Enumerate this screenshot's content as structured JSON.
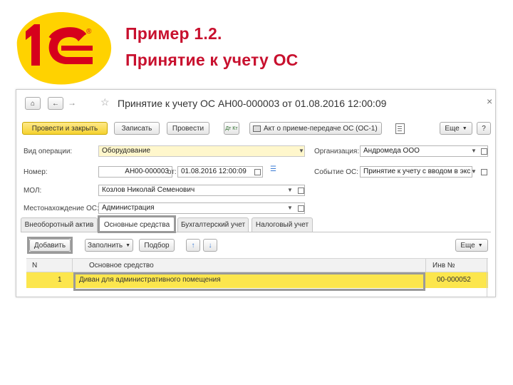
{
  "logo": {
    "text": "1С",
    "mark": "®"
  },
  "slide": {
    "title_line1": "Пример 1.2.",
    "title_line2": "Принятие к учету ОС"
  },
  "window": {
    "title": "Принятие к учету ОС АН00-000003 от 01.08.2016 12:00:09",
    "close": "×",
    "nav": {
      "home_icon": "⌂",
      "back_icon": "←",
      "forward_icon": "→",
      "star_icon": "☆"
    }
  },
  "toolbar": {
    "post_close": "Провести и закрыть",
    "save": "Записать",
    "post": "Провести",
    "dtkt": "Дт Кт",
    "act": "Акт о приеме-передаче ОС (ОС-1)",
    "more": "Еще",
    "help": "?"
  },
  "form": {
    "operation_label": "Вид операции:",
    "operation_value": "Оборудование",
    "number_label": "Номер:",
    "number_value": "АН00-000003",
    "date_from_label": "от:",
    "date_value": "01.08.2016 12:00:09",
    "mol_label": "МОЛ:",
    "mol_value": "Козлов Николай Семенович",
    "location_label": "Местонахождение ОС:",
    "location_value": "Администрация",
    "org_label": "Организация:",
    "org_value": "Андромеда ООО",
    "event_label": "Событие ОС:",
    "event_value": "Принятие к учету с вводом в экс"
  },
  "tabs": [
    "Внеоборотный актив",
    "Основные средства",
    "Бухгалтерский учет",
    "Налоговый учет"
  ],
  "table_toolbar": {
    "add": "Добавить",
    "fill": "Заполнить",
    "select": "Подбор",
    "up_icon": "↑",
    "down_icon": "↓",
    "more": "Еще"
  },
  "table": {
    "columns": [
      "N",
      "Основное средство",
      "Инв №"
    ],
    "rows": [
      {
        "n": "1",
        "asset": "Диван для административного помещения",
        "inv": "00-000052"
      }
    ]
  },
  "colors": {
    "title_red": "#c8102e",
    "logo_red": "#d6001c",
    "logo_yellow": "#ffd200",
    "row_yellow": "#fce64d"
  }
}
